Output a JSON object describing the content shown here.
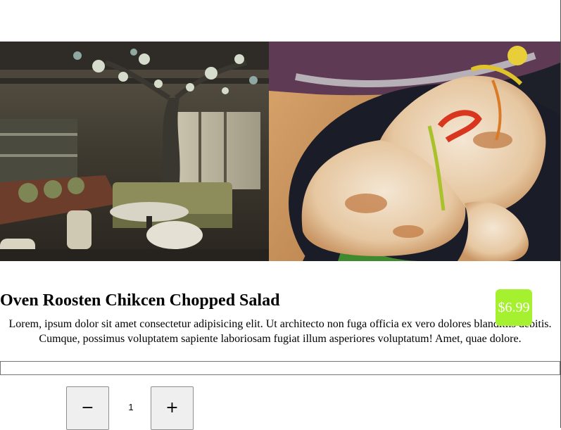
{
  "product": {
    "title": "Oven Roosten Chikcen Chopped Salad",
    "price": "$6.99",
    "description": "Lorem, ipsum dolor sit amet consectetur adipisicing elit. Ut architecto non fuga officia ex vero dolores blanditiis debitis. Cumque, possimus voluptatem sapiente laboriosam fugiat illum asperiores voluptatum! Amet, quae dolore."
  },
  "hero": {
    "left_image": "restaurant-interior-photo",
    "right_image": "dumplings-photo"
  },
  "note_input": {
    "value": ""
  },
  "quantity": {
    "decrement_label": "−",
    "value": "1",
    "increment_label": "+"
  },
  "colors": {
    "price_badge": "#a5f12f"
  }
}
